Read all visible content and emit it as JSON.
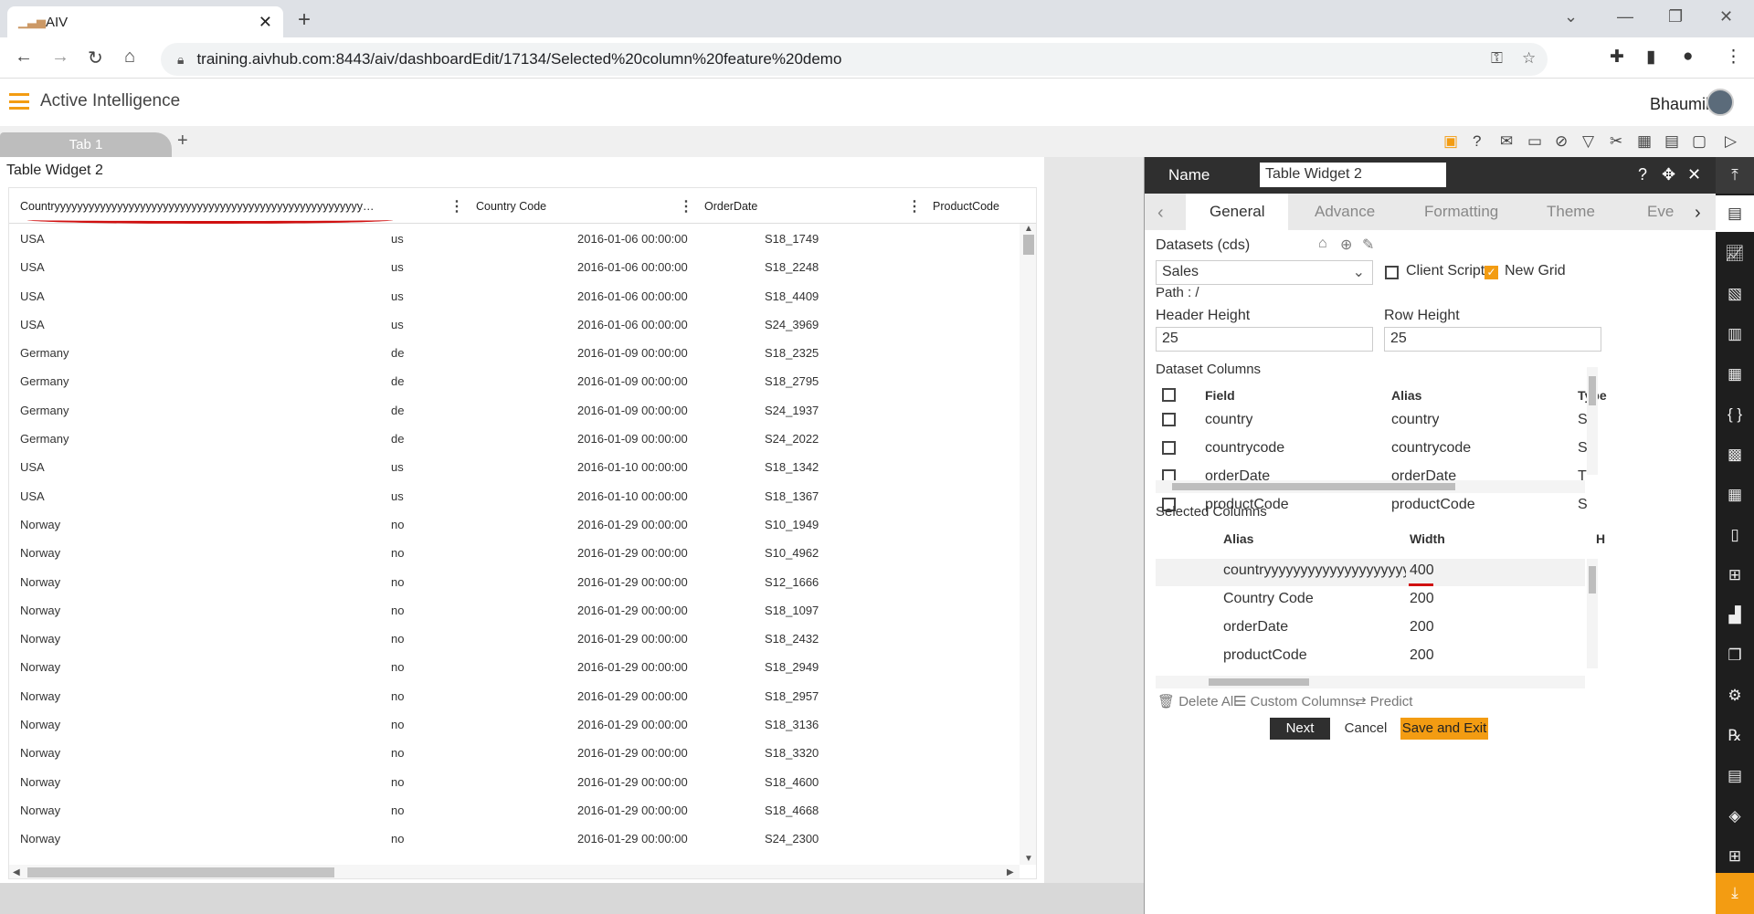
{
  "browser": {
    "tab_title": "AIV",
    "url": "training.aivhub.com:8443/aiv/dashboardEdit/17134/Selected%20column%20feature%20demo"
  },
  "app": {
    "brand": "Active Intelligence",
    "user": "Bhaumik",
    "dashboard_tab": "Tab 1"
  },
  "widget": {
    "title": "Table Widget 2",
    "columns": [
      "Countryyyyyyyyyyyyyyyyyyyyyyyyyyyyyyyyyyyyyyyyyyyyyyyyyyyyyy…",
      "Country Code",
      "OrderDate",
      "ProductCode"
    ],
    "rows": [
      [
        "USA",
        "us",
        "2016-01-06 00:00:00",
        "S18_1749"
      ],
      [
        "USA",
        "us",
        "2016-01-06 00:00:00",
        "S18_2248"
      ],
      [
        "USA",
        "us",
        "2016-01-06 00:00:00",
        "S18_4409"
      ],
      [
        "USA",
        "us",
        "2016-01-06 00:00:00",
        "S24_3969"
      ],
      [
        "Germany",
        "de",
        "2016-01-09 00:00:00",
        "S18_2325"
      ],
      [
        "Germany",
        "de",
        "2016-01-09 00:00:00",
        "S18_2795"
      ],
      [
        "Germany",
        "de",
        "2016-01-09 00:00:00",
        "S24_1937"
      ],
      [
        "Germany",
        "de",
        "2016-01-09 00:00:00",
        "S24_2022"
      ],
      [
        "USA",
        "us",
        "2016-01-10 00:00:00",
        "S18_1342"
      ],
      [
        "USA",
        "us",
        "2016-01-10 00:00:00",
        "S18_1367"
      ],
      [
        "Norway",
        "no",
        "2016-01-29 00:00:00",
        "S10_1949"
      ],
      [
        "Norway",
        "no",
        "2016-01-29 00:00:00",
        "S10_4962"
      ],
      [
        "Norway",
        "no",
        "2016-01-29 00:00:00",
        "S12_1666"
      ],
      [
        "Norway",
        "no",
        "2016-01-29 00:00:00",
        "S18_1097"
      ],
      [
        "Norway",
        "no",
        "2016-01-29 00:00:00",
        "S18_2432"
      ],
      [
        "Norway",
        "no",
        "2016-01-29 00:00:00",
        "S18_2949"
      ],
      [
        "Norway",
        "no",
        "2016-01-29 00:00:00",
        "S18_2957"
      ],
      [
        "Norway",
        "no",
        "2016-01-29 00:00:00",
        "S18_3136"
      ],
      [
        "Norway",
        "no",
        "2016-01-29 00:00:00",
        "S18_3320"
      ],
      [
        "Norway",
        "no",
        "2016-01-29 00:00:00",
        "S18_4600"
      ],
      [
        "Norway",
        "no",
        "2016-01-29 00:00:00",
        "S18_4668"
      ],
      [
        "Norway",
        "no",
        "2016-01-29 00:00:00",
        "S24_2300"
      ]
    ]
  },
  "panel": {
    "name_label": "Name",
    "name_value": "Table Widget 2",
    "tabs": [
      "General",
      "Advance",
      "Formatting",
      "Theme",
      "Eve"
    ],
    "datasets_label": "Datasets (cds)",
    "dataset_value": "Sales",
    "client_script_label": "Client Script",
    "new_grid_label": "New Grid",
    "path_label": "Path : /",
    "header_height_label": "Header Height",
    "header_height_value": "25",
    "row_height_label": "Row Height",
    "row_height_value": "25",
    "dataset_columns_label": "Dataset Columns",
    "dataset_headers": [
      "Field",
      "Alias",
      "Type"
    ],
    "dataset_rows": [
      {
        "field": "country",
        "alias": "country",
        "type": "S"
      },
      {
        "field": "countrycode",
        "alias": "countrycode",
        "type": "S"
      },
      {
        "field": "orderDate",
        "alias": "orderDate",
        "type": "Ti"
      },
      {
        "field": "productCode",
        "alias": "productCode",
        "type": "S"
      }
    ],
    "selected_columns_label": "Selected Columns",
    "selected_headers": [
      "Alias",
      "Width",
      "H"
    ],
    "selected_rows": [
      {
        "alias": "countryyyyyyyyyyyyyyyyyyyy…",
        "width": "400"
      },
      {
        "alias": "Country Code",
        "width": "200"
      },
      {
        "alias": "orderDate",
        "width": "200"
      },
      {
        "alias": "productCode",
        "width": "200"
      }
    ],
    "delete_all": "Delete All",
    "custom_columns": "Custom Columns",
    "predict": "Predict",
    "next": "Next",
    "cancel": "Cancel",
    "save_exit": "Save and Exit"
  },
  "colors": {
    "accent": "#f39c12",
    "dark": "#2f2f2f",
    "annotation": "#d01010"
  }
}
